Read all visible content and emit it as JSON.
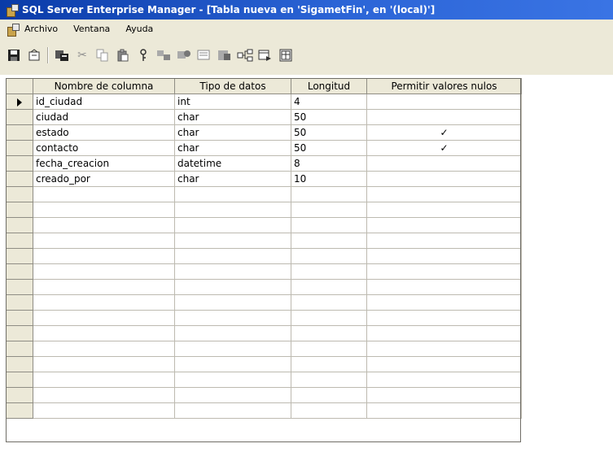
{
  "window": {
    "title": "SQL Server Enterprise Manager - [Tabla nueva en 'SigametFin', en '(local)']"
  },
  "menu": {
    "items": [
      "Archivo",
      "Ventana",
      "Ayuda"
    ]
  },
  "toolbar": {
    "icons": [
      "save-icon",
      "properties-icon",
      "manage-indexes-icon",
      "cut-icon",
      "copy-icon",
      "paste-icon",
      "primary-key-icon",
      "manage-relationships-icon",
      "manage-constraints-icon",
      "generate-script-icon",
      "insert-column-icon",
      "delete-column-icon",
      "relationship-diagram-icon",
      "table-view-icon"
    ]
  },
  "grid": {
    "headers": [
      "Nombre de columna",
      "Tipo de datos",
      "Longitud",
      "Permitir valores nulos"
    ],
    "rows": [
      {
        "name": "id_ciudad",
        "type": "int",
        "length": "4",
        "nullable": false
      },
      {
        "name": "ciudad",
        "type": "char",
        "length": "50",
        "nullable": false
      },
      {
        "name": "estado",
        "type": "char",
        "length": "50",
        "nullable": true
      },
      {
        "name": "contacto",
        "type": "char",
        "length": "50",
        "nullable": true
      },
      {
        "name": "fecha_creacion",
        "type": "datetime",
        "length": "8",
        "nullable": false
      },
      {
        "name": "creado_por",
        "type": "char",
        "length": "10",
        "nullable": false
      }
    ],
    "empty_rows": 15,
    "selected_row": 0
  }
}
